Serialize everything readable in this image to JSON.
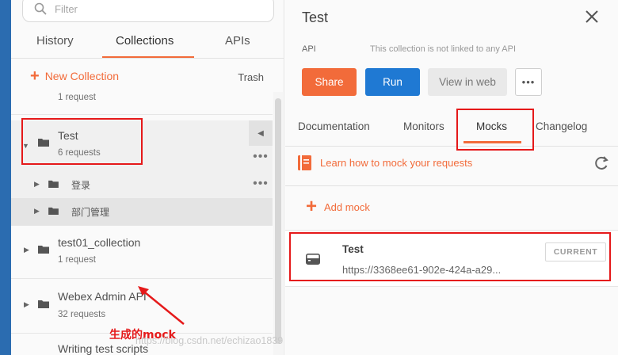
{
  "left": {
    "search": {
      "placeholder": "Filter"
    },
    "tabs": [
      {
        "label": "History"
      },
      {
        "label": "Collections",
        "active": true
      },
      {
        "label": "APIs"
      }
    ],
    "new_collection": "New Collection",
    "trash": "Trash",
    "collections": [
      {
        "requests": "1 request"
      },
      {
        "name": "Test",
        "requests": "6 requests",
        "folders": [
          "登录",
          "部门管理"
        ]
      },
      {
        "name": "test01_collection",
        "requests": "1 request"
      },
      {
        "name": "Webex Admin API",
        "requests": "32 requests"
      },
      {
        "name": "Writing test scripts"
      }
    ]
  },
  "right": {
    "title": "Test",
    "api_label": "API",
    "api_note": "This collection is not linked to any API",
    "buttons": {
      "share": "Share",
      "run": "Run",
      "view": "View in web",
      "more": "•••"
    },
    "tabs": [
      {
        "label": "Documentation"
      },
      {
        "label": "Monitors"
      },
      {
        "label": "Mocks",
        "active": true
      },
      {
        "label": "Changelog"
      }
    ],
    "learn_link": "Learn how to mock your requests",
    "add_mock": "Add mock",
    "mock": {
      "name": "Test",
      "url": "https://3368ee61-902e-424a-a29...",
      "badge": "CURRENT"
    }
  },
  "annotation": "生成的mock",
  "watermark": "https://blog.csdn.net/echizao1839",
  "colors": {
    "accent": "#f26b3a",
    "run": "#1f79d3",
    "annotation": "#e5191a",
    "left_strip": "#2b6cb0"
  },
  "icons": [
    "search-icon",
    "plus-icon",
    "folder-icon",
    "caret-right-icon",
    "caret-down-icon",
    "more-icon",
    "close-icon",
    "docs-icon",
    "refresh-icon",
    "server-icon",
    "arrow-icon"
  ]
}
